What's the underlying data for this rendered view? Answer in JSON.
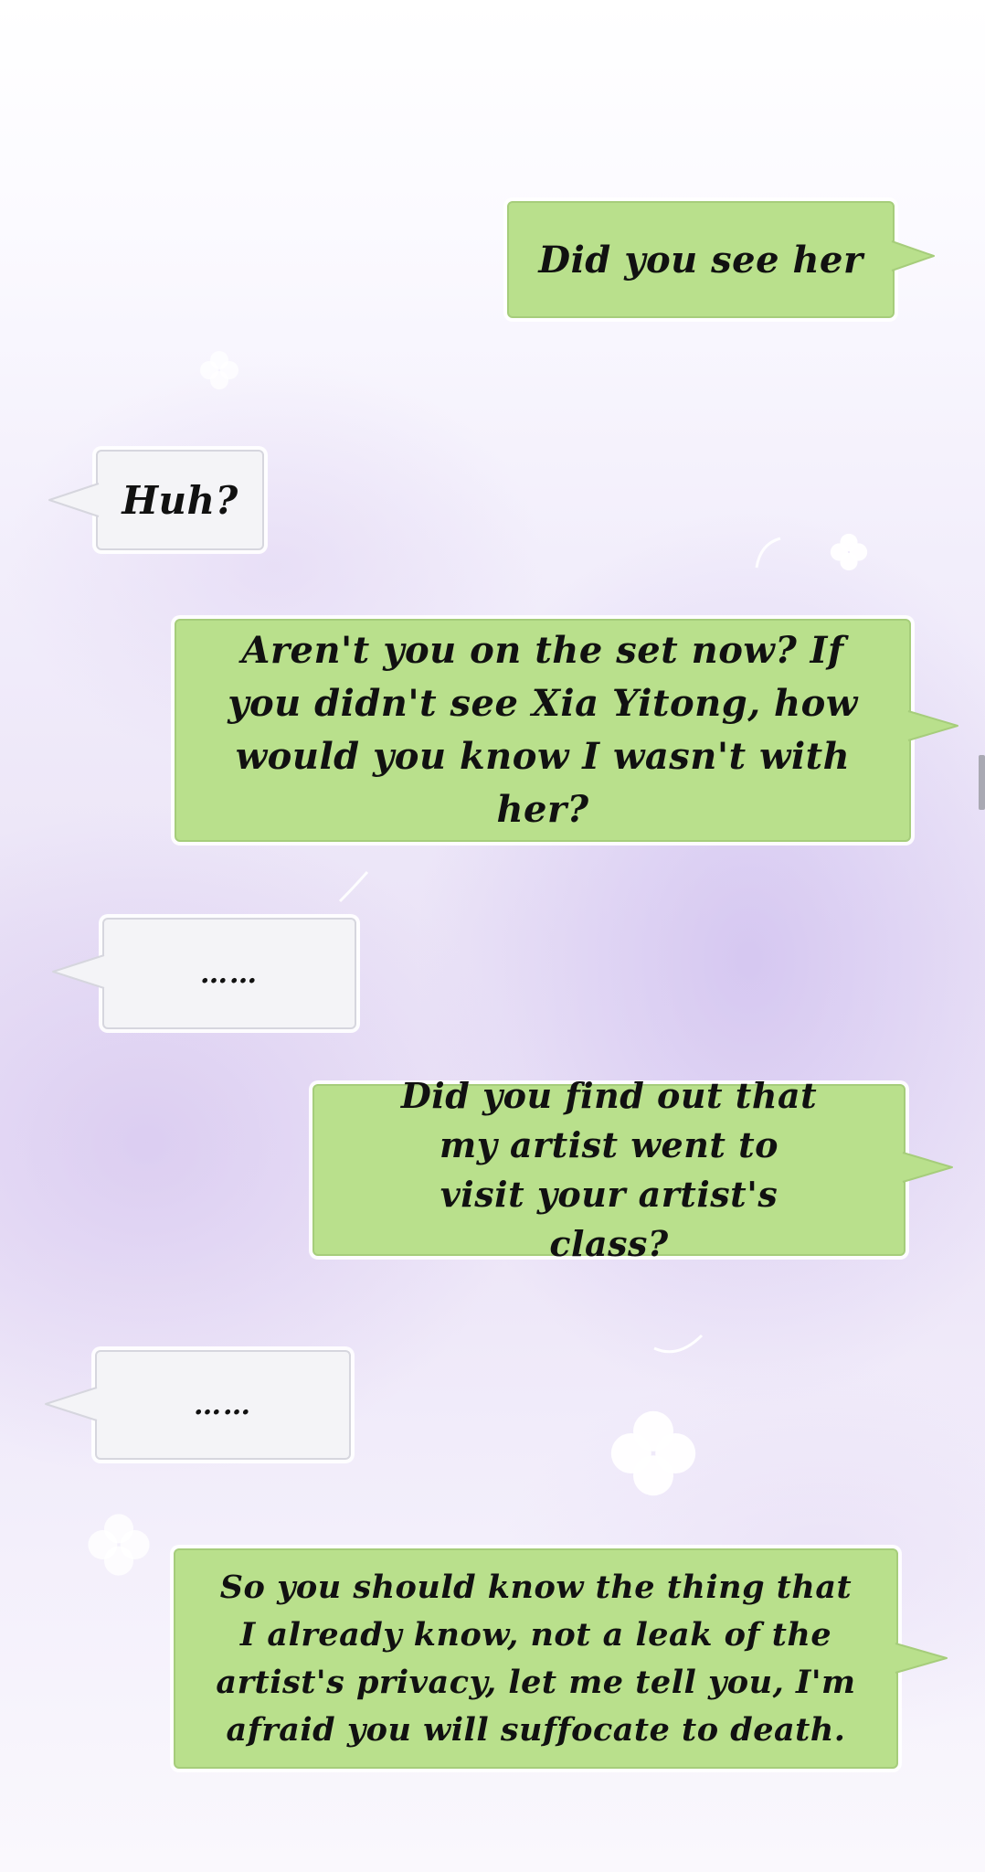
{
  "messages": [
    {
      "id": "m1",
      "side": "right",
      "text": "Did you see her"
    },
    {
      "id": "m2",
      "side": "left",
      "text": "Huh?"
    },
    {
      "id": "m3",
      "side": "right",
      "text": "Aren't you on the set now? If you didn't see Xia Yitong, how would you know I wasn't with her?"
    },
    {
      "id": "m4",
      "side": "left",
      "text": "……"
    },
    {
      "id": "m5",
      "side": "right",
      "text": "Did you find out that my artist went to visit your artist's class?"
    },
    {
      "id": "m6",
      "side": "left",
      "text": "……"
    },
    {
      "id": "m7",
      "side": "right",
      "text": "So you should know the thing that I already know, not a leak of the artist's privacy, let me tell you, I'm afraid you will suffocate to death."
    }
  ],
  "colors": {
    "sent_bubble": "#b9e08c",
    "received_bubble": "#f4f4f7",
    "text": "#111111",
    "background": "#efe9f8"
  }
}
